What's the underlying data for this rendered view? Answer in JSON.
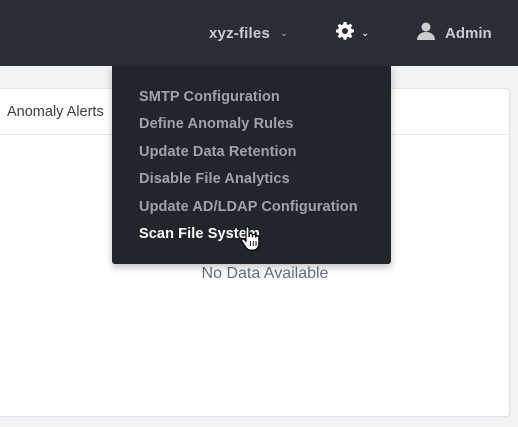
{
  "header": {
    "filesystem": "xyz-files",
    "user": "Admin"
  },
  "settings_menu": {
    "items": [
      {
        "label": "SMTP Configuration",
        "state": "normal"
      },
      {
        "label": "Define Anomaly Rules",
        "state": "normal"
      },
      {
        "label": "Update Data Retention",
        "state": "normal"
      },
      {
        "label": "Disable File Analytics",
        "state": "normal"
      },
      {
        "label": "Update AD/LDAP Configuration",
        "state": "normal"
      },
      {
        "label": "Scan File System",
        "state": "hovered"
      }
    ]
  },
  "widget": {
    "title": "Anomaly Alerts",
    "empty_text": "No Data Available"
  },
  "icons": {
    "settings": "gear-icon",
    "user": "user-icon",
    "pointer": "hand-pointer-icon"
  }
}
